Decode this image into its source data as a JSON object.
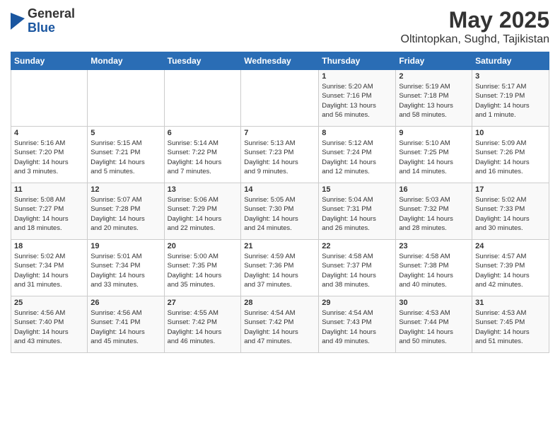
{
  "header": {
    "logo_general": "General",
    "logo_blue": "Blue",
    "title": "May 2025",
    "subtitle": "Oltintopkan, Sughd, Tajikistan"
  },
  "calendar": {
    "days_of_week": [
      "Sunday",
      "Monday",
      "Tuesday",
      "Wednesday",
      "Thursday",
      "Friday",
      "Saturday"
    ],
    "weeks": [
      [
        {
          "day": "",
          "info": ""
        },
        {
          "day": "",
          "info": ""
        },
        {
          "day": "",
          "info": ""
        },
        {
          "day": "",
          "info": ""
        },
        {
          "day": "1",
          "info": "Sunrise: 5:20 AM\nSunset: 7:16 PM\nDaylight: 13 hours\nand 56 minutes."
        },
        {
          "day": "2",
          "info": "Sunrise: 5:19 AM\nSunset: 7:18 PM\nDaylight: 13 hours\nand 58 minutes."
        },
        {
          "day": "3",
          "info": "Sunrise: 5:17 AM\nSunset: 7:19 PM\nDaylight: 14 hours\nand 1 minute."
        }
      ],
      [
        {
          "day": "4",
          "info": "Sunrise: 5:16 AM\nSunset: 7:20 PM\nDaylight: 14 hours\nand 3 minutes."
        },
        {
          "day": "5",
          "info": "Sunrise: 5:15 AM\nSunset: 7:21 PM\nDaylight: 14 hours\nand 5 minutes."
        },
        {
          "day": "6",
          "info": "Sunrise: 5:14 AM\nSunset: 7:22 PM\nDaylight: 14 hours\nand 7 minutes."
        },
        {
          "day": "7",
          "info": "Sunrise: 5:13 AM\nSunset: 7:23 PM\nDaylight: 14 hours\nand 9 minutes."
        },
        {
          "day": "8",
          "info": "Sunrise: 5:12 AM\nSunset: 7:24 PM\nDaylight: 14 hours\nand 12 minutes."
        },
        {
          "day": "9",
          "info": "Sunrise: 5:10 AM\nSunset: 7:25 PM\nDaylight: 14 hours\nand 14 minutes."
        },
        {
          "day": "10",
          "info": "Sunrise: 5:09 AM\nSunset: 7:26 PM\nDaylight: 14 hours\nand 16 minutes."
        }
      ],
      [
        {
          "day": "11",
          "info": "Sunrise: 5:08 AM\nSunset: 7:27 PM\nDaylight: 14 hours\nand 18 minutes."
        },
        {
          "day": "12",
          "info": "Sunrise: 5:07 AM\nSunset: 7:28 PM\nDaylight: 14 hours\nand 20 minutes."
        },
        {
          "day": "13",
          "info": "Sunrise: 5:06 AM\nSunset: 7:29 PM\nDaylight: 14 hours\nand 22 minutes."
        },
        {
          "day": "14",
          "info": "Sunrise: 5:05 AM\nSunset: 7:30 PM\nDaylight: 14 hours\nand 24 minutes."
        },
        {
          "day": "15",
          "info": "Sunrise: 5:04 AM\nSunset: 7:31 PM\nDaylight: 14 hours\nand 26 minutes."
        },
        {
          "day": "16",
          "info": "Sunrise: 5:03 AM\nSunset: 7:32 PM\nDaylight: 14 hours\nand 28 minutes."
        },
        {
          "day": "17",
          "info": "Sunrise: 5:02 AM\nSunset: 7:33 PM\nDaylight: 14 hours\nand 30 minutes."
        }
      ],
      [
        {
          "day": "18",
          "info": "Sunrise: 5:02 AM\nSunset: 7:34 PM\nDaylight: 14 hours\nand 31 minutes."
        },
        {
          "day": "19",
          "info": "Sunrise: 5:01 AM\nSunset: 7:34 PM\nDaylight: 14 hours\nand 33 minutes."
        },
        {
          "day": "20",
          "info": "Sunrise: 5:00 AM\nSunset: 7:35 PM\nDaylight: 14 hours\nand 35 minutes."
        },
        {
          "day": "21",
          "info": "Sunrise: 4:59 AM\nSunset: 7:36 PM\nDaylight: 14 hours\nand 37 minutes."
        },
        {
          "day": "22",
          "info": "Sunrise: 4:58 AM\nSunset: 7:37 PM\nDaylight: 14 hours\nand 38 minutes."
        },
        {
          "day": "23",
          "info": "Sunrise: 4:58 AM\nSunset: 7:38 PM\nDaylight: 14 hours\nand 40 minutes."
        },
        {
          "day": "24",
          "info": "Sunrise: 4:57 AM\nSunset: 7:39 PM\nDaylight: 14 hours\nand 42 minutes."
        }
      ],
      [
        {
          "day": "25",
          "info": "Sunrise: 4:56 AM\nSunset: 7:40 PM\nDaylight: 14 hours\nand 43 minutes."
        },
        {
          "day": "26",
          "info": "Sunrise: 4:56 AM\nSunset: 7:41 PM\nDaylight: 14 hours\nand 45 minutes."
        },
        {
          "day": "27",
          "info": "Sunrise: 4:55 AM\nSunset: 7:42 PM\nDaylight: 14 hours\nand 46 minutes."
        },
        {
          "day": "28",
          "info": "Sunrise: 4:54 AM\nSunset: 7:42 PM\nDaylight: 14 hours\nand 47 minutes."
        },
        {
          "day": "29",
          "info": "Sunrise: 4:54 AM\nSunset: 7:43 PM\nDaylight: 14 hours\nand 49 minutes."
        },
        {
          "day": "30",
          "info": "Sunrise: 4:53 AM\nSunset: 7:44 PM\nDaylight: 14 hours\nand 50 minutes."
        },
        {
          "day": "31",
          "info": "Sunrise: 4:53 AM\nSunset: 7:45 PM\nDaylight: 14 hours\nand 51 minutes."
        }
      ]
    ]
  }
}
